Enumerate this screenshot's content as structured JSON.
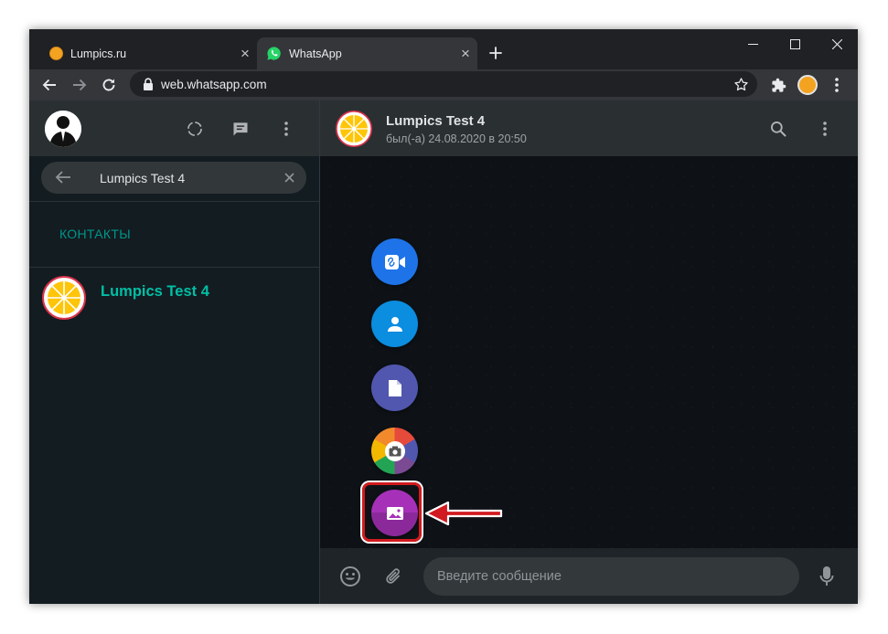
{
  "browser": {
    "tabs": [
      {
        "title": "Lumpics.ru",
        "close": "×"
      },
      {
        "title": "WhatsApp",
        "close": "×"
      }
    ],
    "new_tab": "+",
    "url": "web.whatsapp.com"
  },
  "sidebar": {
    "search": {
      "value": "Lumpics Test 4"
    },
    "section_label": "КОНТАКТЫ",
    "contacts": [
      {
        "name": "Lumpics Test 4"
      }
    ]
  },
  "chat": {
    "name": "Lumpics Test 4",
    "status": "был(-а) 24.08.2020 в 20:50",
    "attach_menu": [
      "room-video-icon",
      "contact-icon",
      "document-icon",
      "camera-icon",
      "gallery-icon"
    ],
    "highlighted": "gallery-icon",
    "composer": {
      "placeholder": "Введите сообщение",
      "value": ""
    }
  },
  "colors": {
    "accent": "#00bfa5",
    "section": "#009688",
    "highlight": "#d11b20",
    "video": "#1e73e8",
    "contact": "#0b8de0",
    "document": "#5157ae",
    "gallery": "#a631b8"
  }
}
